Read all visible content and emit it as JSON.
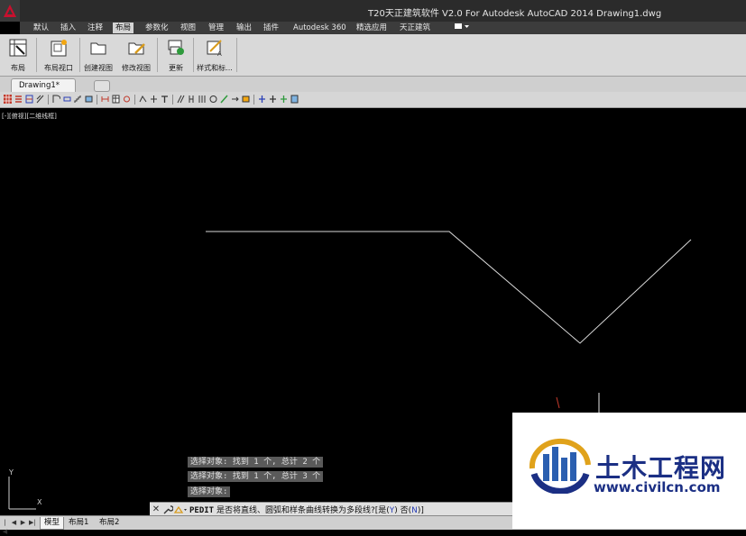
{
  "window": {
    "title": "T20天正建筑软件 V2.0 For Autodesk AutoCAD 2014    Drawing1.dwg"
  },
  "menu": {
    "items": [
      "默认",
      "插入",
      "注释",
      "布局",
      "参数化",
      "视图",
      "管理",
      "输出",
      "插件",
      "Autodesk 360",
      "精选应用",
      "天正建筑"
    ],
    "active": "布局"
  },
  "ribbon": {
    "buttons": [
      {
        "label": "布局",
        "icon": "layout-icon"
      },
      {
        "label": "布局视口",
        "icon": "layout-viewport-icon"
      },
      {
        "label": "创建视图",
        "icon": "create-view-icon"
      },
      {
        "label": "修改视图",
        "icon": "modify-view-icon"
      },
      {
        "label": "更新",
        "icon": "update-icon"
      },
      {
        "label": "样式和标...",
        "icon": "styles-icon"
      }
    ]
  },
  "document": {
    "tab_label": "Drawing1*"
  },
  "viewport": {
    "label": "[-][俯视][二维线框]"
  },
  "command": {
    "history": [
      "选择对象: 找到 1 个, 总计 2 个",
      "选择对象: 找到 1 个, 总计 3 个",
      "选择对象:"
    ],
    "prompt_keyword": "PEDIT",
    "prompt_text": "是否将直线、圆弧和样条曲线转换为多段线?",
    "option_bracket_open": "[",
    "option_yes_label": "是(",
    "option_yes_key": "Y",
    "option_yes_close": ")",
    "option_no_label": " 否(",
    "option_no_key": "N",
    "option_no_close": ")",
    "option_bracket_close": "]"
  },
  "ucs": {
    "x_label": "X",
    "y_label": "Y"
  },
  "layout_tabs": [
    "模型",
    "布局1",
    "布局2"
  ],
  "layout_active": "模型",
  "watermark": {
    "title": "土木工程网",
    "url": "www.civilcn.com"
  },
  "colors": {
    "canvas_bg": "#000000",
    "line": "#d9d9d9",
    "ribbon_bg": "#d9d9d9",
    "brand_blue": "#1b2f84",
    "option_blue": "#2a3fb6"
  }
}
